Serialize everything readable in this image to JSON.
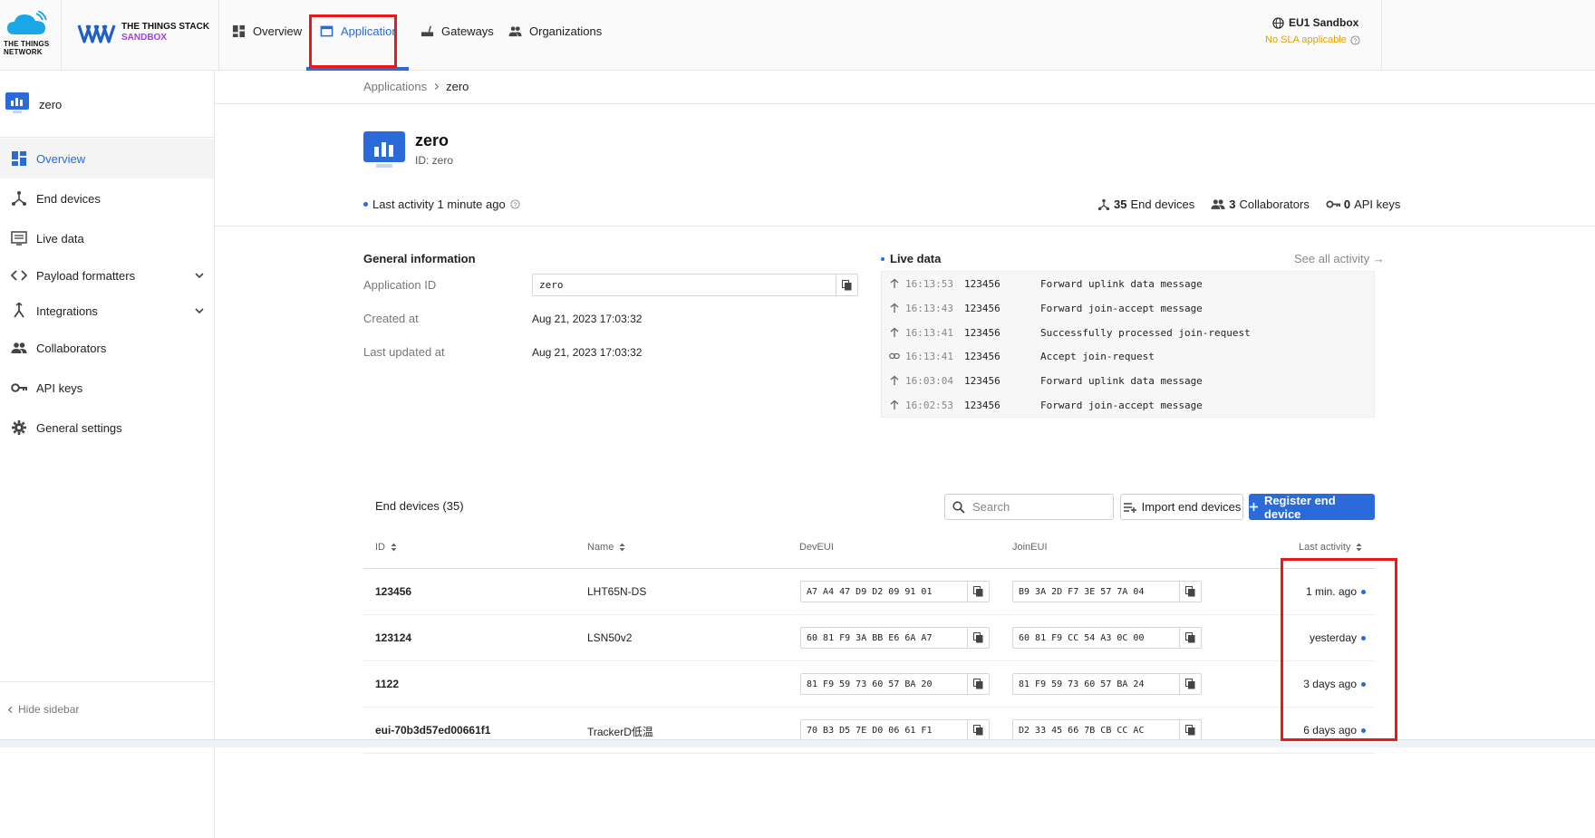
{
  "brand": {
    "ttn_line1": "THE THINGS",
    "ttn_line2": "NETWORK",
    "tts_line1": "THE THINGS STACK",
    "tts_line2": "SANDBOX"
  },
  "nav": {
    "items": [
      {
        "label": "Overview",
        "icon": "dashboard-icon"
      },
      {
        "label": "Applications",
        "icon": "application-icon",
        "active": true
      },
      {
        "label": "Gateways",
        "icon": "router-icon"
      },
      {
        "label": "Organizations",
        "icon": "people-icon"
      }
    ]
  },
  "cluster": {
    "name": "EU1 Sandbox",
    "sla": "No SLA applicable"
  },
  "sidebar": {
    "app_name": "zero",
    "items": [
      {
        "label": "Overview",
        "icon": "dashboard-icon",
        "active": true
      },
      {
        "label": "End devices",
        "icon": "device-hub-icon"
      },
      {
        "label": "Live data",
        "icon": "live-data-icon"
      },
      {
        "label": "Payload formatters",
        "icon": "code-icon",
        "expandable": true
      },
      {
        "label": "Integrations",
        "icon": "integrations-icon",
        "expandable": true
      },
      {
        "label": "Collaborators",
        "icon": "people-icon"
      },
      {
        "label": "API keys",
        "icon": "key-icon"
      },
      {
        "label": "General settings",
        "icon": "gear-icon"
      }
    ],
    "hide_label": "Hide sidebar"
  },
  "breadcrumb": {
    "parent": "Applications",
    "current": "zero"
  },
  "app": {
    "title": "zero",
    "id_label": "ID: zero",
    "last_activity": "Last activity 1 minute ago",
    "stats": {
      "end_devices_count": "35",
      "end_devices_label": "End devices",
      "collaborators_count": "3",
      "collaborators_label": "Collaborators",
      "api_keys_count": "0",
      "api_keys_label": "API keys"
    }
  },
  "general": {
    "title": "General information",
    "app_id_label": "Application ID",
    "app_id_value": "zero",
    "created_label": "Created at",
    "created_value": "Aug 21, 2023 17:03:32",
    "updated_label": "Last updated at",
    "updated_value": "Aug 21, 2023 17:03:32"
  },
  "live": {
    "title": "Live data",
    "see_all": "See all activity →",
    "events": [
      {
        "icon": "arrow-up-icon",
        "time": "16:13:53",
        "device": "123456",
        "message": "Forward uplink data message"
      },
      {
        "icon": "arrow-up-icon",
        "time": "16:13:43",
        "device": "123456",
        "message": "Forward join-accept message"
      },
      {
        "icon": "arrow-up-icon",
        "time": "16:13:41",
        "device": "123456",
        "message": "Successfully processed join-request"
      },
      {
        "icon": "link-icon",
        "time": "16:13:41",
        "device": "123456",
        "message": "Accept join-request"
      },
      {
        "icon": "arrow-up-icon",
        "time": "16:03:04",
        "device": "123456",
        "message": "Forward uplink data message"
      },
      {
        "icon": "arrow-up-icon",
        "time": "16:02:53",
        "device": "123456",
        "message": "Forward join-accept message"
      }
    ]
  },
  "devices": {
    "title": "End devices (35)",
    "search_placeholder": "Search",
    "import_label": "Import end devices",
    "register_label": "Register end device",
    "columns": [
      "ID",
      "Name",
      "DevEUI",
      "JoinEUI",
      "Last activity"
    ],
    "rows": [
      {
        "id": "123456",
        "name": "LHT65N-DS",
        "dev_eui": "A7 A4 47 D9 D2 09 91 01",
        "join_eui": "B9 3A 2D F7 3E 57 7A 04",
        "last": "1 min. ago"
      },
      {
        "id": "123124",
        "name": "LSN50v2",
        "dev_eui": "60 81 F9 3A BB E6 6A A7",
        "join_eui": "60 81 F9 CC 54 A3 0C 00",
        "last": "yesterday"
      },
      {
        "id": "1122",
        "name": "",
        "dev_eui": "81 F9 59 73 60 57 BA 20",
        "join_eui": "81 F9 59 73 60 57 BA 24",
        "last": "3 days ago"
      },
      {
        "id": "eui-70b3d57ed00661f1",
        "name": "TrackerD低温",
        "dev_eui": "70 B3 D5 7E D0 06 61 F1",
        "join_eui": "D2 33 45 66 7B CB CC AC",
        "last": "6 days ago"
      }
    ]
  },
  "colors": {
    "accent": "#2a6bd9",
    "highlight": "#e8191a",
    "warning": "#e6a000",
    "sandbox": "#a63ce8"
  }
}
